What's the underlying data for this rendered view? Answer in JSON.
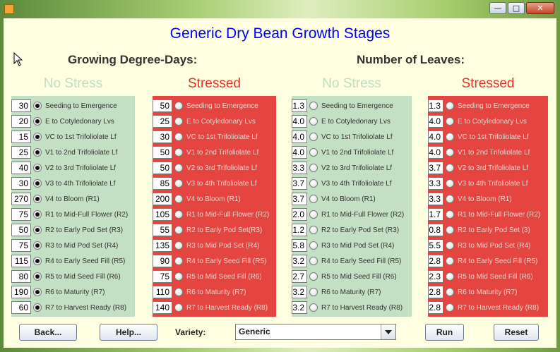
{
  "window": {
    "controls": {
      "minimize": "—",
      "maximize": "□",
      "close": "✕"
    }
  },
  "header": {
    "title": "Generic Dry Bean Growth Stages"
  },
  "sections": {
    "gdd": "Growing Degree-Days:",
    "leaves": "Number of Leaves:"
  },
  "columns": {
    "gdd_no_stress": {
      "heading": "No Stress",
      "rows": [
        {
          "value": "30",
          "label": "Seeding to Emergence",
          "selected": true
        },
        {
          "value": "20",
          "label": "E to Cotyledonary Lvs",
          "selected": true
        },
        {
          "value": "15",
          "label": "VC to 1st Trifoliolate Lf",
          "selected": true
        },
        {
          "value": "25",
          "label": "V1 to 2nd Trifoliolate Lf",
          "selected": true
        },
        {
          "value": "40",
          "label": "V2 to 3rd Trifoliolate Lf",
          "selected": true
        },
        {
          "value": "30",
          "label": "V3 to 4th Trifoliolate Lf",
          "selected": true
        },
        {
          "value": "270",
          "label": "V4 to Bloom (R1)",
          "selected": true
        },
        {
          "value": "75",
          "label": "R1 to Mid-Full Flower (R2)",
          "selected": true
        },
        {
          "value": "50",
          "label": "R2 to Early Pod Set (R3)",
          "selected": true
        },
        {
          "value": "75",
          "label": "R3 to Mid Pod Set (R4)",
          "selected": true
        },
        {
          "value": "115",
          "label": "R4 to Early Seed Fill (R5)",
          "selected": true
        },
        {
          "value": "80",
          "label": "R5 to Mid Seed Fill (R6)",
          "selected": true
        },
        {
          "value": "190",
          "label": "R6 to Maturity (R7)",
          "selected": true
        },
        {
          "value": "60",
          "label": "R7 to Harvest Ready (R8)",
          "selected": true
        }
      ]
    },
    "gdd_stressed": {
      "heading": "Stressed",
      "rows": [
        {
          "value": "50",
          "label": "Seeding to Emergence",
          "selected": false
        },
        {
          "value": "25",
          "label": "E to Cotyledonary Lvs",
          "selected": false
        },
        {
          "value": "30",
          "label": "VC to 1st Trifoliolate Lf",
          "selected": false
        },
        {
          "value": "50",
          "label": "V1 to 2nd Trifoliolate Lf",
          "selected": false
        },
        {
          "value": "50",
          "label": "V2 to 3rd Trifoliolate Lf",
          "selected": false
        },
        {
          "value": "85",
          "label": "V3 to 4th Trifoliolate Lf",
          "selected": false
        },
        {
          "value": "200",
          "label": "V4 to Bloom (R1)",
          "selected": false
        },
        {
          "value": "105",
          "label": "R1 to Mid-Full Flower (R2)",
          "selected": false
        },
        {
          "value": "55",
          "label": "R2 to Early Pod Set(R3)",
          "selected": false
        },
        {
          "value": "135",
          "label": "R3 to Mid Pod Set (R4)",
          "selected": false
        },
        {
          "value": "90",
          "label": "R4 to Early Seed Fill (R5)",
          "selected": false
        },
        {
          "value": "75",
          "label": "R5 to Mid Seed Fill (R6)",
          "selected": false
        },
        {
          "value": "110",
          "label": "R6 to Maturity (R7)",
          "selected": false
        },
        {
          "value": "140",
          "label": "R7 to Harvest Ready (R8)",
          "selected": false
        }
      ]
    },
    "leaves_no_stress": {
      "heading": "No Stress",
      "rows": [
        {
          "value": "1.3",
          "label": "Seeding to Emergence",
          "selected": false
        },
        {
          "value": "4.0",
          "label": "E to Cotyledonary Lvs",
          "selected": false
        },
        {
          "value": "4.0",
          "label": "VC to 1st Trifoliolate Lf",
          "selected": false
        },
        {
          "value": "4.0",
          "label": "V1 to 2nd Trifoliolate Lf",
          "selected": false
        },
        {
          "value": "3.3",
          "label": "V2 to 3rd Trifoliolate Lf",
          "selected": false
        },
        {
          "value": "3.7",
          "label": "V3 to 4th Trifoliolate Lf",
          "selected": false
        },
        {
          "value": "3.7",
          "label": "V4 to Bloom (R1)",
          "selected": false
        },
        {
          "value": "2.0",
          "label": "R1 to Mid-Full Flower (R2)",
          "selected": false
        },
        {
          "value": "1.2",
          "label": "R2 to Early Pod Set (R3)",
          "selected": false
        },
        {
          "value": "5.8",
          "label": "R3 to Mid Pod Set (R4)",
          "selected": false
        },
        {
          "value": "3.2",
          "label": "R4 to Early Seed Fill (R5)",
          "selected": false
        },
        {
          "value": "2.7",
          "label": "R5 to Mid Seed Fill (R6)",
          "selected": false
        },
        {
          "value": "3.2",
          "label": "R6 to Maturity (R7)",
          "selected": false
        },
        {
          "value": "3.2",
          "label": "R7 to Harvest Ready (R8)",
          "selected": false
        }
      ]
    },
    "leaves_stressed": {
      "heading": "Stressed",
      "rows": [
        {
          "value": "1.3",
          "label": "Seeding to Emergence",
          "selected": false
        },
        {
          "value": "4.0",
          "label": "E to Cotyledonary Lvs",
          "selected": false
        },
        {
          "value": "4.0",
          "label": "VC to 1st Trifoliolate Lf",
          "selected": false
        },
        {
          "value": "4.0",
          "label": "V1 to 2nd Trifoliolate Lf",
          "selected": false
        },
        {
          "value": "3.7",
          "label": "V2 to 3rd Trifoliolate Lf",
          "selected": false
        },
        {
          "value": "3.3",
          "label": "V3 to 4th Trifoliolate Lf",
          "selected": false
        },
        {
          "value": "3.3",
          "label": "V4 to Bloom (R1)",
          "selected": false
        },
        {
          "value": "1.7",
          "label": "R1 to Mid-Full Flower (R2)",
          "selected": false
        },
        {
          "value": "0.8",
          "label": "R2 to Early Pod Set (3)",
          "selected": false
        },
        {
          "value": "5.5",
          "label": "R3 to Mid Pod Set (R4)",
          "selected": false
        },
        {
          "value": "2.8",
          "label": "R4 to Early Seed Fill (R5)",
          "selected": false
        },
        {
          "value": "2.3",
          "label": "R5 to Mid Seed Fill (R6)",
          "selected": false
        },
        {
          "value": "2.8",
          "label": "R6 to Maturity (R7)",
          "selected": false
        },
        {
          "value": "2.8",
          "label": "R7 to Harvest Ready (R8)",
          "selected": false
        }
      ]
    }
  },
  "footer": {
    "back": "Back...",
    "help": "Help...",
    "variety_label": "Variety:",
    "variety_value": "Generic",
    "run": "Run",
    "reset": "Reset"
  },
  "colors": {
    "title": "#0000ff",
    "no_stress_panel": "#c4e0c4",
    "stressed_panel": "#e44540",
    "stressed_heading": "#e0342a",
    "no_stress_heading": "#c4ddc4",
    "background": "#ffffe1"
  }
}
